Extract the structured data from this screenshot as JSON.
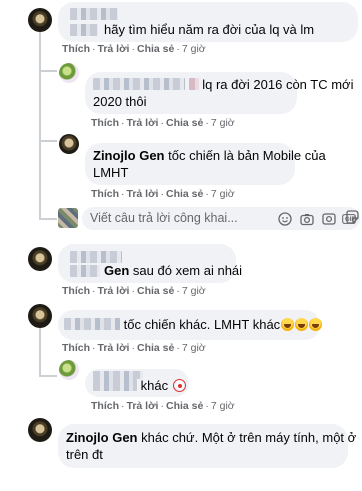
{
  "comments": [
    {
      "text": "hãy tìm hiểu năm ra đời của lq và lm",
      "actions": {
        "like": "Thích",
        "reply": "Trả lời",
        "share": "Chia sẻ",
        "time": "7 giờ"
      }
    },
    {
      "text": "lq ra đời 2016 còn TC mới 2020 thôi",
      "text_line1": "lq ra đời 2016 còn TC mới",
      "text_line2": "2020 thôi",
      "actions": {
        "like": "Thích",
        "reply": "Trả lời",
        "share": "Chia sẻ",
        "time": "7 giờ"
      }
    },
    {
      "name": "Zinojlo Gen",
      "text_line1": "tốc chiến là bản Mobile của",
      "text_line2": "LMHT",
      "actions": {
        "like": "Thích",
        "reply": "Trả lời",
        "share": "Chia sẻ",
        "time": "7 giờ"
      }
    },
    {
      "name_fragment": "Gen",
      "text": "sau đó xem ai nhái",
      "actions": {
        "like": "Thích",
        "reply": "Trả lời",
        "share": "Chia sẻ",
        "time": "7 giờ"
      }
    },
    {
      "text": "tốc chiến khác. LMHT khác",
      "actions": {
        "like": "Thích",
        "reply": "Trả lời",
        "share": "Chia sẻ",
        "time": "7 giờ"
      }
    },
    {
      "text": "khác",
      "actions": {
        "like": "Thích",
        "reply": "Trả lời",
        "share": "Chia sẻ",
        "time": "7 giờ"
      }
    },
    {
      "name": "Zinojlo Gen",
      "text_line1": "khác chứ. Một ở trên máy tính, một ở",
      "text_line2": "trên đt"
    }
  ],
  "reply_box": {
    "placeholder": "Viết câu trả lời công khai...",
    "icons": [
      "smiley-icon",
      "camera-icon",
      "camera-icon",
      "gif-icon",
      "sticker-icon"
    ],
    "gif_label": "GIF"
  },
  "colors": {
    "bubble": "#f0f2f5",
    "meta_text": "#65676b",
    "body_text": "#050505"
  }
}
